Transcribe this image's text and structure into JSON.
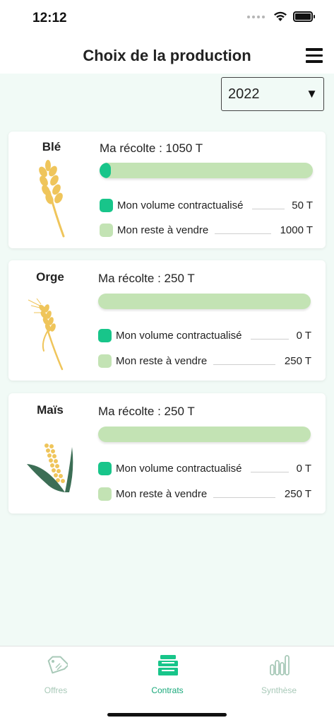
{
  "status": {
    "time": "12:12"
  },
  "header": {
    "title": "Choix de la production",
    "menu_icon": "hamburger-icon"
  },
  "year_selector": {
    "value": "2022",
    "caret": "▼"
  },
  "colors": {
    "contracted": "#18c58a",
    "remaining": "#c3e3b4",
    "accent": "#18a87a",
    "inactive_tab": "#a8c9b8"
  },
  "crops": [
    {
      "name": "Blé",
      "icon": "wheat-icon",
      "harvest": "Ma récolte : 1050 T",
      "contracted_fraction": 0.05,
      "contracted_label": "Mon volume contractualisé",
      "contracted_value": "50 T",
      "remaining_label": "Mon reste à vendre",
      "remaining_value": "1000 T"
    },
    {
      "name": "Orge",
      "icon": "barley-icon",
      "harvest": "Ma récolte : 250 T",
      "contracted_fraction": 0,
      "contracted_label": "Mon volume contractualisé",
      "contracted_value": "0 T",
      "remaining_label": "Mon reste à vendre",
      "remaining_value": "250 T"
    },
    {
      "name": "Maïs",
      "icon": "corn-icon",
      "harvest": "Ma récolte : 250 T",
      "contracted_fraction": 0,
      "contracted_label": "Mon volume contractualisé",
      "contracted_value": "0 T",
      "remaining_label": "Mon reste à vendre",
      "remaining_value": "250 T"
    }
  ],
  "tabs": [
    {
      "label": "Offres",
      "icon": "price-tag-icon",
      "active": false
    },
    {
      "label": "Contrats",
      "icon": "contracts-stack-icon",
      "active": true
    },
    {
      "label": "Synthèse",
      "icon": "bar-chart-icon",
      "active": false
    }
  ]
}
